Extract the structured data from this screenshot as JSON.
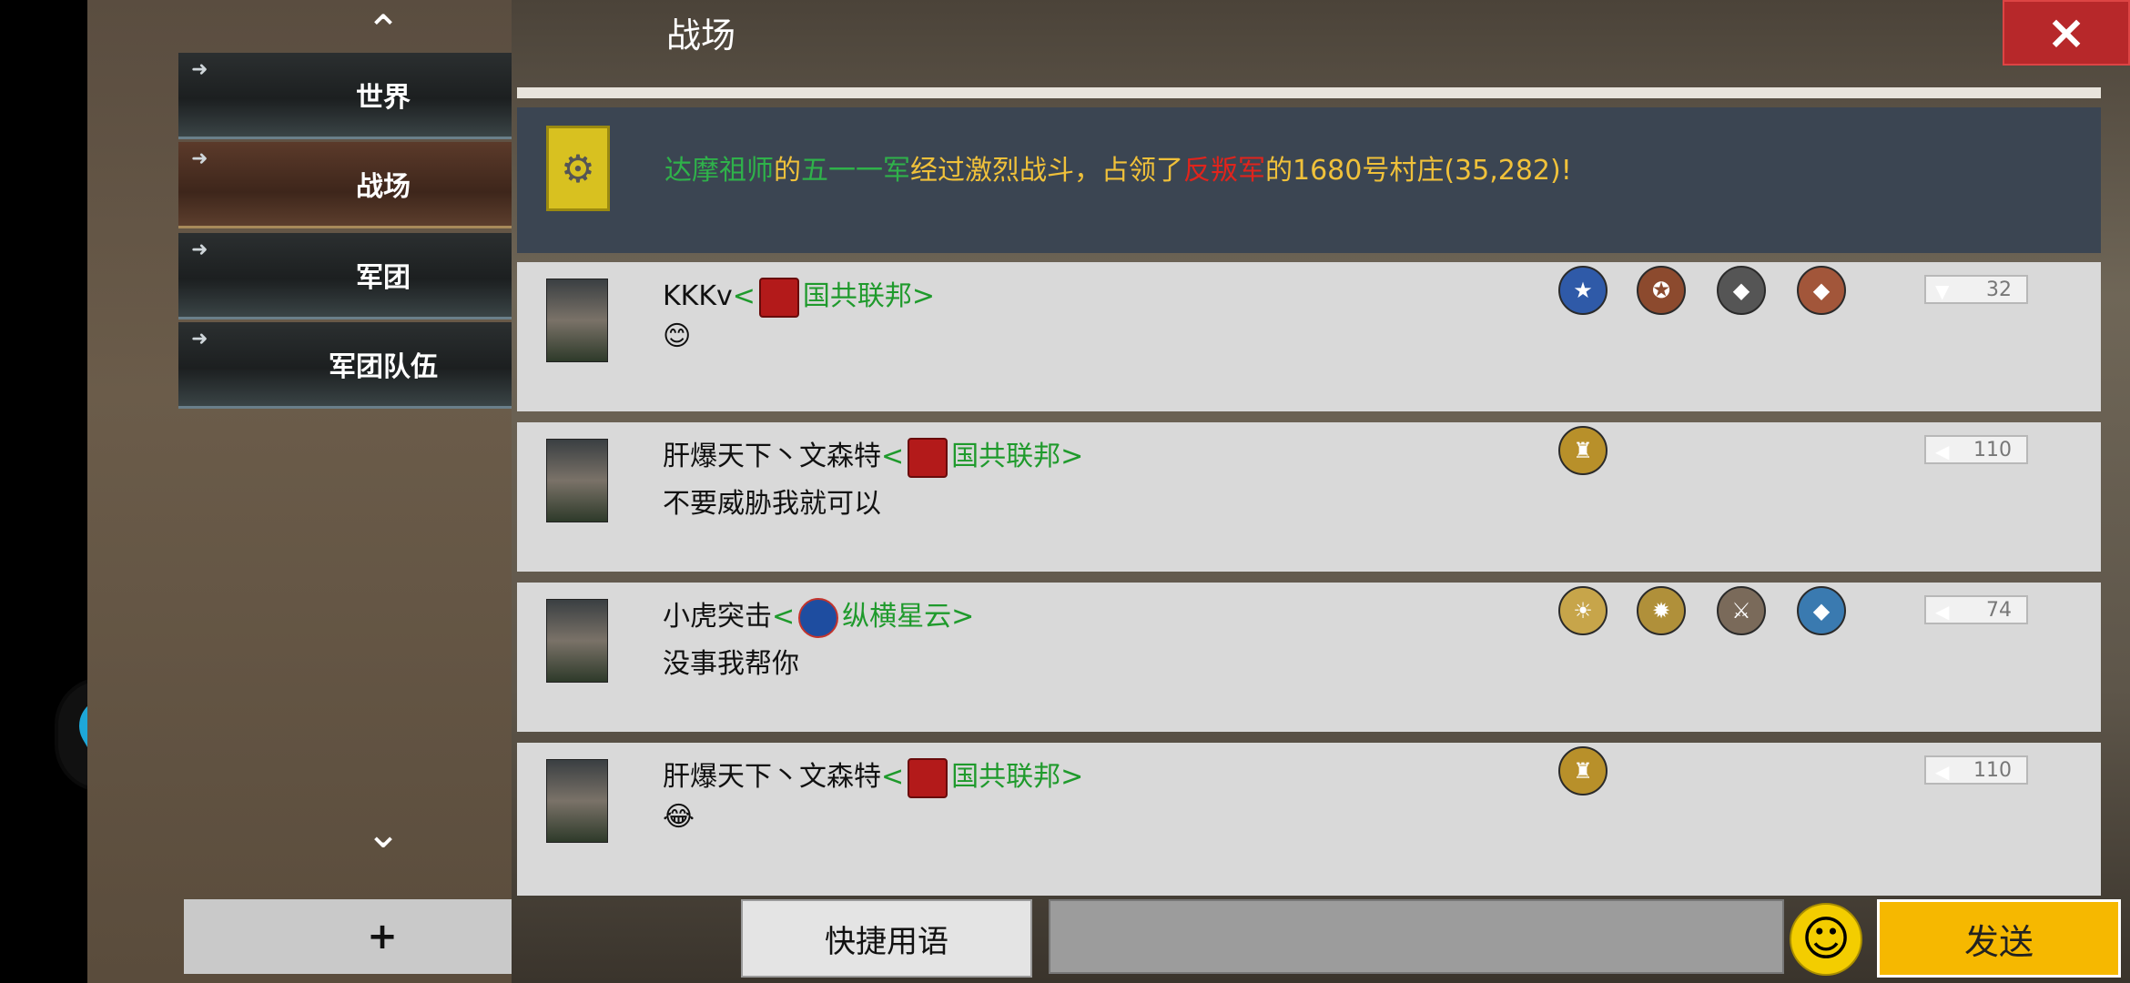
{
  "header": {
    "title": "战场",
    "close_icon": "×"
  },
  "sidebar": {
    "up_icon": "⌃",
    "down_icon": "⌄",
    "channels": [
      {
        "label": "世界",
        "active": false,
        "notification": true
      },
      {
        "label": "战场",
        "active": true,
        "notification": false
      },
      {
        "label": "军团",
        "active": false,
        "notification": false
      },
      {
        "label": "军团队伍",
        "active": false,
        "notification": false
      }
    ],
    "add_label": "+"
  },
  "system_message": {
    "parts": {
      "p1": "达摩祖师",
      "p2": "的",
      "p3": "五一一军",
      "p4": "经过激烈战斗，占领了",
      "p5": "反叛军",
      "p6": "的1680号村庄(35,282)!"
    },
    "colors": {
      "green": "#2fb24a",
      "yellow": "#f0c13a",
      "red": "#e0241c"
    }
  },
  "messages": [
    {
      "user": "KKKv",
      "corps_open": "<",
      "corps": "国共联邦",
      "corps_close": ">",
      "text": "😊",
      "level": "32"
    },
    {
      "user": "肝爆天下丶文森特",
      "corps_open": "<",
      "corps": "国共联邦",
      "corps_close": ">",
      "text": "不要威胁我就可以",
      "level": "110"
    },
    {
      "user": "小虎突击",
      "corps_open": "<",
      "corps": "纵横星云",
      "corps_close": ">",
      "text": "没事我帮你",
      "level": "74"
    },
    {
      "user": "肝爆天下丶文森特",
      "corps_open": "<",
      "corps": "国共联邦",
      "corps_close": ">",
      "text": "😂",
      "level": "110"
    }
  ],
  "footer": {
    "quick_phrases": "快捷用语",
    "send": "发送",
    "emoji_icon": "☺"
  }
}
